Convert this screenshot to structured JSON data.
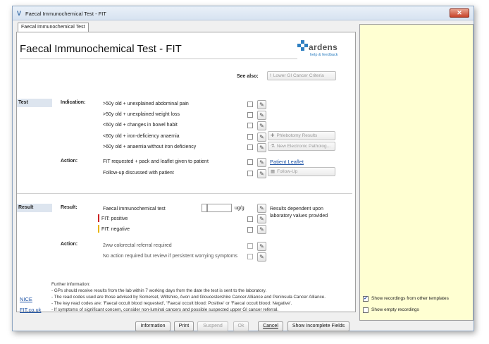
{
  "window": {
    "title": "Faecal Immunochemical Test - FIT",
    "close_glyph": "✕"
  },
  "tab": {
    "label": "Faecal Immunochemical Test"
  },
  "header": {
    "title": "Faecal Immunochemical Test - FIT",
    "logo_text": "ardens",
    "logo_sub": "help & feedback"
  },
  "see_also": {
    "label": "See also:",
    "button": "Lower GI Cancer Criteria"
  },
  "test": {
    "section": "Test",
    "indication_label": "Indication:",
    "indications": [
      ">50y old + unexplained abdominal pain",
      ">50y old + unexplained weight loss",
      "<60y old + changes in bowel habit",
      "<60y old + iron-deficiency anaemia",
      ">60y old + anaemia without iron deficiency"
    ],
    "phlebotomy_button": "Phlebotomy Results",
    "pathology_button": "New Electronic Patholog...",
    "action_label": "Action:",
    "actions": [
      "FIT requested + pack and leaflet given to patient",
      "Follow-up discussed with patient"
    ],
    "patient_leaflet_link": "Patient Leaflet",
    "followup_button": "Follow-Up"
  },
  "result": {
    "section": "Result",
    "result_label": "Result:",
    "fit_test_label": "Faecal immunochemical test",
    "unit": "ug/g",
    "dependent_note": "Results dependent upon laboratory values provided",
    "positive_label": "FIT: positive",
    "negative_label": "FIT: negative",
    "positive_color": "#cc2222",
    "negative_color": "#e8b400",
    "action_label": "Action:",
    "actions": [
      "2ww colorectal referral required",
      "No action required but review if persistent worrying symptoms"
    ]
  },
  "further_info": {
    "title": "Further information:",
    "lines": [
      "- GPs should receive results from the lab within 7 working days from the date the test is sent to the laboratory.",
      "- The read codes used are those advised by Somerset, Wiltshire, Avon and Gloucestershire Cancer Alliance and Peninsula Cancer Alliance.",
      "- The key read codes are: 'Faecal occult blood requested', 'Faecal occult blood: Positive' or 'Faecal occult blood: Negative'.",
      "- If symptoms of significant concern, consider non-luminal cancers and possible suspected upper GI cancer referral."
    ],
    "links": [
      "NICE",
      "FIT.co.uk"
    ]
  },
  "sidebar": {
    "show_other_templates": "Show recordings from other templates",
    "show_other_checked": "✓",
    "show_empty": "Show empty recordings"
  },
  "buttons": {
    "information": "Information",
    "print": "Print",
    "suspend": "Suspend",
    "ok": "Ok",
    "cancel": "Cancel",
    "show_incomplete": "Show Incomplete Fields"
  },
  "icons": {
    "pencil": "✎",
    "exclaim": "!",
    "syringe": "✚",
    "flask": "⚗",
    "calendar": "▦"
  }
}
